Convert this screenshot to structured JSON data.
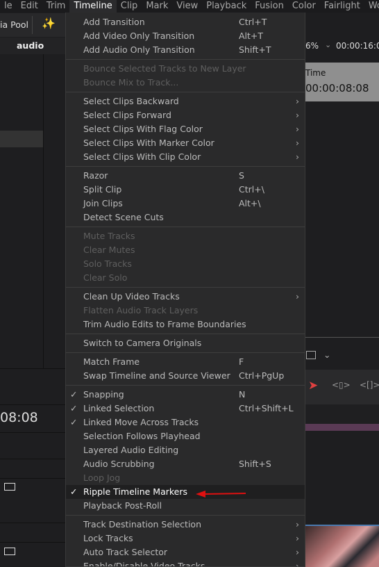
{
  "menubar": [
    "le",
    "Edit",
    "Trim",
    "Timeline",
    "Clip",
    "Mark",
    "View",
    "Playback",
    "Fusion",
    "Color",
    "Fairlight",
    "Work"
  ],
  "toolbar": {
    "media_pool": "ia Pool",
    "bin_name": "audio",
    "zoom": "6%",
    "timecode_top": "00:00:16:0"
  },
  "viewer": {
    "time_label": "Time",
    "time_value": "00:00:08:08"
  },
  "left_timecode": "08:08",
  "menu": {
    "groups": [
      [
        {
          "label": "Add Transition",
          "shortcut": "Ctrl+T"
        },
        {
          "label": "Add Video Only Transition",
          "shortcut": "Alt+T"
        },
        {
          "label": "Add Audio Only Transition",
          "shortcut": "Shift+T"
        }
      ],
      [
        {
          "label": "Bounce Selected Tracks to New Layer",
          "disabled": true
        },
        {
          "label": "Bounce Mix to Track...",
          "disabled": true
        }
      ],
      [
        {
          "label": "Select Clips Backward",
          "submenu": true
        },
        {
          "label": "Select Clips Forward",
          "submenu": true
        },
        {
          "label": "Select Clips With Flag Color",
          "submenu": true
        },
        {
          "label": "Select Clips With Marker Color",
          "submenu": true
        },
        {
          "label": "Select Clips With Clip Color",
          "submenu": true
        }
      ],
      [
        {
          "label": "Razor",
          "shortcut": "S"
        },
        {
          "label": "Split Clip",
          "shortcut": "Ctrl+\\"
        },
        {
          "label": "Join Clips",
          "shortcut": "Alt+\\"
        },
        {
          "label": "Detect Scene Cuts"
        }
      ],
      [
        {
          "label": "Mute Tracks",
          "disabled": true
        },
        {
          "label": "Clear Mutes",
          "disabled": true
        },
        {
          "label": "Solo Tracks",
          "disabled": true
        },
        {
          "label": "Clear Solo",
          "disabled": true
        }
      ],
      [
        {
          "label": "Clean Up Video Tracks",
          "submenu": true
        },
        {
          "label": "Flatten Audio Track Layers",
          "disabled": true
        },
        {
          "label": "Trim Audio Edits to Frame Boundaries"
        }
      ],
      [
        {
          "label": "Switch to Camera Originals"
        }
      ],
      [
        {
          "label": "Match Frame",
          "shortcut": "F"
        },
        {
          "label": "Swap Timeline and Source Viewer",
          "shortcut": "Ctrl+PgUp"
        }
      ],
      [
        {
          "label": "Snapping",
          "shortcut": "N",
          "checked": true
        },
        {
          "label": "Linked Selection",
          "shortcut": "Ctrl+Shift+L",
          "checked": true
        },
        {
          "label": "Linked Move Across Tracks",
          "checked": true
        },
        {
          "label": "Selection Follows Playhead"
        },
        {
          "label": "Layered Audio Editing"
        },
        {
          "label": "Audio Scrubbing",
          "shortcut": "Shift+S"
        },
        {
          "label": "Loop Jog",
          "disabled": true
        },
        {
          "label": "Ripple Timeline Markers",
          "checked": true,
          "highlighted": true
        },
        {
          "label": "Playback Post-Roll"
        }
      ],
      [
        {
          "label": "Track Destination Selection",
          "submenu": true
        },
        {
          "label": "Lock Tracks",
          "submenu": true
        },
        {
          "label": "Auto Track Selector",
          "submenu": true
        },
        {
          "label": "Enable/Disable Video Tracks",
          "submenu": true
        }
      ]
    ]
  },
  "colors": {
    "annotation_arrow": "#e01010",
    "bg": "#1e1e20",
    "menu_bg": "#2a2a2b"
  }
}
